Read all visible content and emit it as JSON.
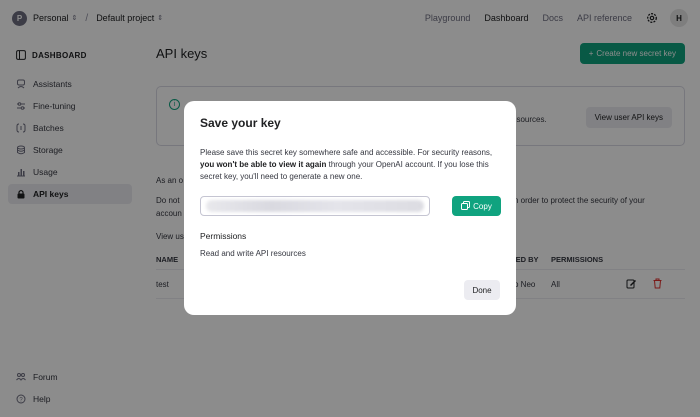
{
  "topbar": {
    "org_initial": "P",
    "org_name": "Personal",
    "project_name": "Default project",
    "nav": [
      "Playground",
      "Dashboard",
      "Docs",
      "API reference"
    ],
    "active_nav": "Dashboard",
    "user_initial": "H"
  },
  "sidebar": {
    "heading": "DASHBOARD",
    "items": [
      {
        "label": "Assistants",
        "icon": "assistant-icon"
      },
      {
        "label": "Fine-tuning",
        "icon": "sliders-icon"
      },
      {
        "label": "Batches",
        "icon": "batch-icon"
      },
      {
        "label": "Storage",
        "icon": "database-icon"
      },
      {
        "label": "Usage",
        "icon": "chart-icon"
      },
      {
        "label": "API keys",
        "icon": "lock-icon"
      }
    ],
    "active_item": "API keys",
    "bottom": [
      {
        "label": "Forum",
        "icon": "people-icon"
      },
      {
        "label": "Help",
        "icon": "help-icon"
      }
    ]
  },
  "main": {
    "title": "API keys",
    "create_button": "Create new secret key",
    "info_text_visible": "esources.",
    "view_user_keys_button": "View user API keys",
    "line1": "As an o",
    "line2a": "Do not",
    "line2b": "accoun",
    "line2c": "n order to protect the security of your",
    "line3": "View us",
    "table": {
      "headers": {
        "name": "NAME",
        "created_by": "TED BY",
        "permissions": "PERMISSIONS"
      },
      "rows": [
        {
          "name": "test",
          "created_by": "o Neo",
          "permissions": "All"
        }
      ]
    }
  },
  "modal": {
    "title": "Save your key",
    "desc_part1": "Please save this secret key somewhere safe and accessible. For security reasons, ",
    "desc_bold": "you won't be able to view it again",
    "desc_part2": " through your OpenAI account. If you lose this secret key, you'll need to generate a new one.",
    "copy_button": "Copy",
    "permissions_heading": "Permissions",
    "permissions_value": "Read and write API resources",
    "done_button": "Done"
  },
  "colors": {
    "accent": "#10a37f",
    "overlay": "rgba(0,0,0,0.45)"
  }
}
